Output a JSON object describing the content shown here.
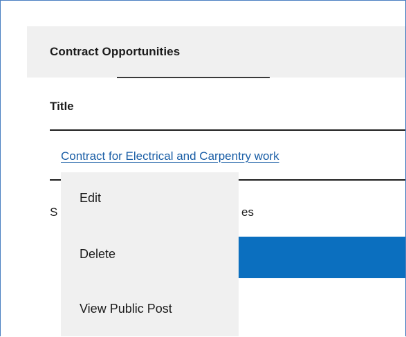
{
  "panel": {
    "title": "Contract Opportunities"
  },
  "table": {
    "column_header": "Title",
    "rows": [
      {
        "title": "Contract for Electrical and Carpentry work"
      }
    ]
  },
  "footer": {
    "text_left": "S",
    "text_right": "es"
  },
  "context_menu": {
    "items": [
      {
        "label": "Edit"
      },
      {
        "label": "Delete"
      },
      {
        "label": "View Public Post"
      }
    ]
  },
  "colors": {
    "link": "#1a5ea6",
    "accent_bar": "#0b6fbf",
    "panel_background": "#f0f0f0",
    "frame_border": "#4a7fc1"
  }
}
